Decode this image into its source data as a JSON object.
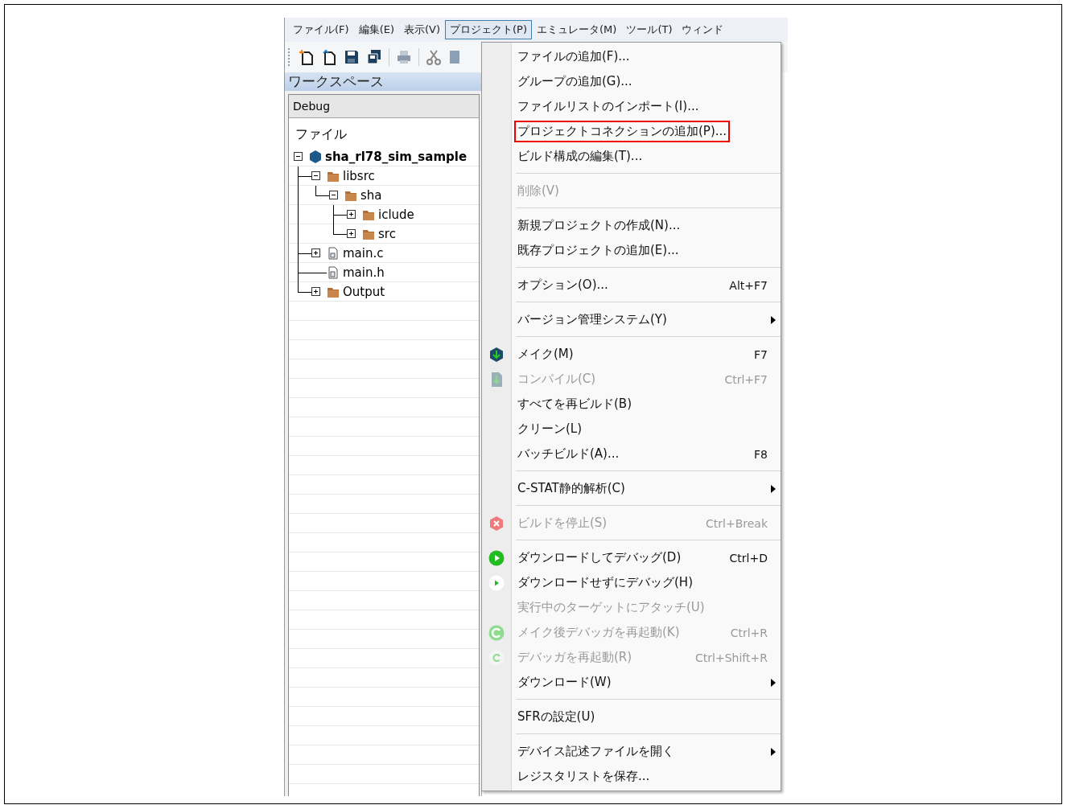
{
  "menubar": [
    {
      "label": "ファイル(F)",
      "selected": false
    },
    {
      "label": "編集(E)",
      "selected": false
    },
    {
      "label": "表示(V)",
      "selected": false
    },
    {
      "label": "プロジェクト(P)",
      "selected": true
    },
    {
      "label": "エミュレータ(M)",
      "selected": false
    },
    {
      "label": "ツール(T)",
      "selected": false
    },
    {
      "label": "ウィンド",
      "selected": false
    }
  ],
  "toolbar": [
    {
      "kind": "new-file"
    },
    {
      "kind": "open-file"
    },
    {
      "kind": "save"
    },
    {
      "kind": "save-all"
    },
    {
      "kind": "sep"
    },
    {
      "kind": "print"
    },
    {
      "kind": "sep"
    },
    {
      "kind": "cut"
    },
    {
      "kind": "copy"
    }
  ],
  "workspace": {
    "title": "ワークスペース",
    "configuration": "Debug",
    "column": "ファイル",
    "tree": [
      {
        "label": "sha_rl78_sim_sample",
        "kind": "project",
        "expanded": true,
        "children": [
          {
            "label": "libsrc",
            "kind": "folder",
            "expanded": true,
            "children": [
              {
                "label": "sha",
                "kind": "folder",
                "expanded": true,
                "children": [
                  {
                    "label": "iclude",
                    "kind": "folder",
                    "expanded": false
                  },
                  {
                    "label": "src",
                    "kind": "folder",
                    "expanded": false
                  }
                ]
              }
            ]
          },
          {
            "label": "main.c",
            "kind": "c-file",
            "expanded": false
          },
          {
            "label": "main.h",
            "kind": "h-file"
          },
          {
            "label": "Output",
            "kind": "folder",
            "expanded": false
          }
        ]
      }
    ]
  },
  "menu": [
    {
      "kind": "item",
      "label": "ファイルの追加(F)...",
      "disabled": false,
      "highlighted": false
    },
    {
      "kind": "item",
      "label": "グループの追加(G)...",
      "disabled": false,
      "highlighted": false
    },
    {
      "kind": "item",
      "label": "ファイルリストのインポート(I)...",
      "disabled": false,
      "highlighted": false
    },
    {
      "kind": "item",
      "label": "プロジェクトコネクションの追加(P)...",
      "disabled": false,
      "highlighted": true
    },
    {
      "kind": "item",
      "label": "ビルド構成の編集(T)...",
      "disabled": false,
      "highlighted": false
    },
    {
      "kind": "separator"
    },
    {
      "kind": "item",
      "label": "削除(V)",
      "disabled": true,
      "highlighted": false
    },
    {
      "kind": "separator"
    },
    {
      "kind": "item",
      "label": "新規プロジェクトの作成(N)...",
      "disabled": false,
      "highlighted": false
    },
    {
      "kind": "item",
      "label": "既存プロジェクトの追加(E)...",
      "disabled": false,
      "highlighted": false
    },
    {
      "kind": "separator"
    },
    {
      "kind": "item",
      "label": "オプション(O)...",
      "shortcut": "Alt+F7",
      "disabled": false,
      "highlighted": false
    },
    {
      "kind": "separator"
    },
    {
      "kind": "submenu",
      "label": "バージョン管理システム(Y)",
      "disabled": false,
      "highlighted": false
    },
    {
      "kind": "separator"
    },
    {
      "kind": "make",
      "label": "メイク(M)",
      "shortcut": "F7",
      "disabled": false,
      "highlighted": false
    },
    {
      "kind": "compile",
      "label": "コンパイル(C)",
      "shortcut": "Ctrl+F7",
      "disabled": true,
      "highlighted": false
    },
    {
      "kind": "item",
      "label": "すべてを再ビルド(B)",
      "disabled": false,
      "highlighted": false
    },
    {
      "kind": "item",
      "label": "クリーン(L)",
      "disabled": false,
      "highlighted": false
    },
    {
      "kind": "item",
      "label": "バッチビルド(A)...",
      "shortcut": "F8",
      "disabled": false,
      "highlighted": false
    },
    {
      "kind": "separator"
    },
    {
      "kind": "submenu",
      "label": "C-STAT静的解析(C)",
      "disabled": false,
      "highlighted": false
    },
    {
      "kind": "separator"
    },
    {
      "kind": "stop",
      "label": "ビルドを停止(S)",
      "shortcut": "Ctrl+Break",
      "disabled": true,
      "highlighted": false
    },
    {
      "kind": "separator"
    },
    {
      "kind": "debug",
      "label": "ダウンロードしてデバッグ(D)",
      "shortcut": "Ctrl+D",
      "disabled": false,
      "highlighted": false
    },
    {
      "kind": "debug-plain",
      "label": "ダウンロードせずにデバッグ(H)",
      "disabled": false,
      "highlighted": false
    },
    {
      "kind": "item",
      "label": "実行中のターゲットにアタッチ(U)",
      "disabled": true,
      "highlighted": false
    },
    {
      "kind": "restart-circle",
      "label": "メイク後デバッガを再起動(K)",
      "shortcut": "Ctrl+R",
      "disabled": true,
      "highlighted": false
    },
    {
      "kind": "restart",
      "label": "デバッガを再起動(R)",
      "shortcut": "Ctrl+Shift+R",
      "disabled": true,
      "highlighted": false
    },
    {
      "kind": "submenu",
      "label": "ダウンロード(W)",
      "disabled": false,
      "highlighted": false
    },
    {
      "kind": "separator"
    },
    {
      "kind": "item",
      "label": "SFRの設定(U)",
      "disabled": false,
      "highlighted": false
    },
    {
      "kind": "separator"
    },
    {
      "kind": "submenu",
      "label": "デバイス記述ファイルを開く",
      "disabled": false,
      "highlighted": false
    },
    {
      "kind": "item",
      "label": "レジスタリストを保存...",
      "disabled": false,
      "highlighted": false
    }
  ]
}
